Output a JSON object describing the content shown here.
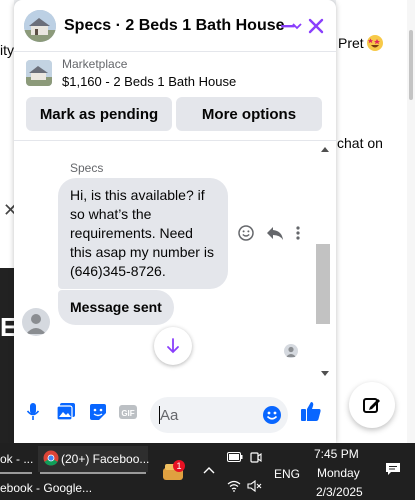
{
  "background": {
    "left_fragment": "ity",
    "right_fragment": "Pret",
    "right_fragment_2": "chat on"
  },
  "chat": {
    "title": "Specs · 2 Beds 1 Bath House",
    "marketplace_label": "Marketplace",
    "listing": "$1,160 - 2 Beds 1 Bath House",
    "mark_pending_label": "Mark as pending",
    "more_options_label": "More options",
    "sender_name": "Specs",
    "messages": [
      "Hi, is this available? if so what’s the requirements. Need this asap my number is (646)345-8726.",
      "Message sent"
    ],
    "input_placeholder": "Aa",
    "accent_color": "#8a3ffc",
    "brand_color": "#0866ff"
  },
  "taskbar": {
    "app1_label": "ok - ...",
    "app2_label": "(20+) Faceboo...",
    "app3_label": "ebook - Google...",
    "badge_count": "1",
    "language": "ENG",
    "time": "7:45 PM",
    "day": "Monday",
    "date": "2/3/2025"
  }
}
